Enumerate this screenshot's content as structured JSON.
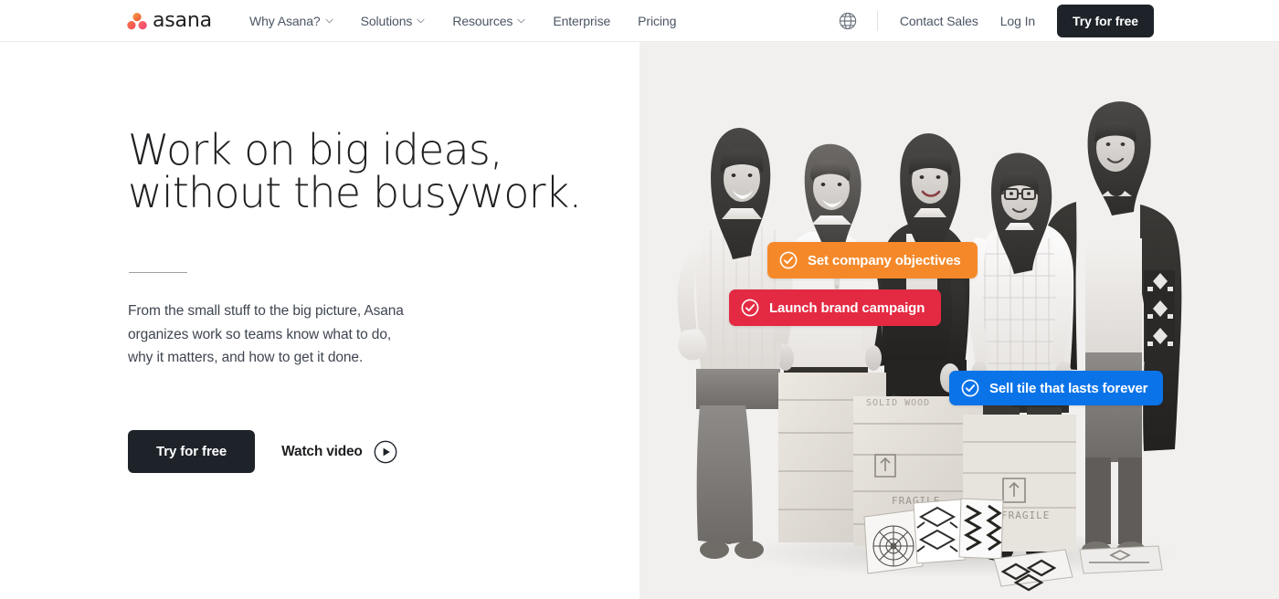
{
  "header": {
    "logo": {
      "wordmark": "asana",
      "icon": "asana-logo-icon"
    },
    "nav": [
      {
        "label": "Why Asana?",
        "has_dropdown": true
      },
      {
        "label": "Solutions",
        "has_dropdown": true
      },
      {
        "label": "Resources",
        "has_dropdown": true
      },
      {
        "label": "Enterprise",
        "has_dropdown": false
      },
      {
        "label": "Pricing",
        "has_dropdown": false
      }
    ],
    "language_icon": "globe-icon",
    "contact_sales": "Contact Sales",
    "log_in": "Log In",
    "try_free": "Try for free"
  },
  "hero": {
    "headline": "Work on big ideas,\nwithout the busywork.",
    "subcopy": "From the small stuff to the big picture, Asana\norganizes work so teams know what to do,\nwhy it matters, and how to get it done.",
    "primary_cta": "Try for free",
    "secondary_cta": "Watch video",
    "secondary_cta_icon": "play-circle-icon"
  },
  "pills": [
    {
      "label": "Set company objectives",
      "color": "#F5892A",
      "icon": "check-circle-icon"
    },
    {
      "label": "Launch brand campaign",
      "color": "#E42A43",
      "icon": "check-circle-icon"
    },
    {
      "label": "Sell tile that lasts forever",
      "color": "#0B73E8",
      "icon": "check-circle-icon"
    }
  ],
  "colors": {
    "dark": "#1E2329",
    "text_body": "#3F4550",
    "nav_text": "#4B5563",
    "panel_bg": "#F1F0EF",
    "page_bg": "#FFFFFF",
    "logo_coral": "#F06A6A",
    "logo_red": "#FC636B",
    "logo_pink": "#F06A9C"
  }
}
